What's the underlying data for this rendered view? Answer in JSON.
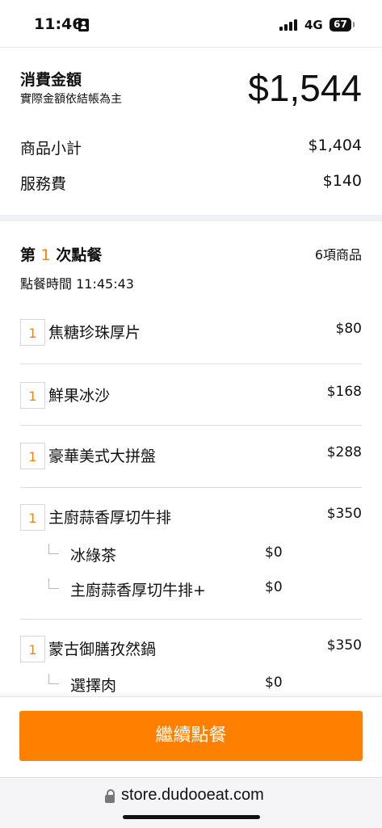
{
  "status": {
    "time": "11:46",
    "network": "4G",
    "battery": "67"
  },
  "summary": {
    "total_label": "消費金額",
    "total_note": "實際金額依結帳為主",
    "total_amount": "$1,544",
    "subtotal_label": "商品小計",
    "subtotal_value": "$1,404",
    "service_label": "服務費",
    "service_value": "$140"
  },
  "order": {
    "title_prefix": "第",
    "title_number": "1",
    "title_suffix": "次點餐",
    "item_count": "6項商品",
    "time": "點餐時間 11:45:43",
    "items": [
      {
        "qty": "1",
        "name": "焦糖珍珠厚片",
        "price": "$80",
        "options": []
      },
      {
        "qty": "1",
        "name": "鮮果冰沙",
        "price": "$168",
        "options": []
      },
      {
        "qty": "1",
        "name": "豪華美式大拼盤",
        "price": "$288",
        "options": []
      },
      {
        "qty": "1",
        "name": "主廚蒜香厚切牛排",
        "price": "$350",
        "options": [
          {
            "name": "冰綠茶",
            "price": "$0"
          },
          {
            "name": "主廚蒜香厚切牛排+",
            "price": "$0"
          }
        ]
      },
      {
        "qty": "1",
        "name": "蒙古御膳孜然鍋",
        "price": "$350",
        "options": [
          {
            "name": "選擇肉",
            "price": "$0"
          }
        ]
      }
    ]
  },
  "actions": {
    "continue_label": "繼續點餐"
  },
  "browser": {
    "url": "store.dudooeat.com"
  },
  "colors": {
    "accent": "#ff8000"
  }
}
